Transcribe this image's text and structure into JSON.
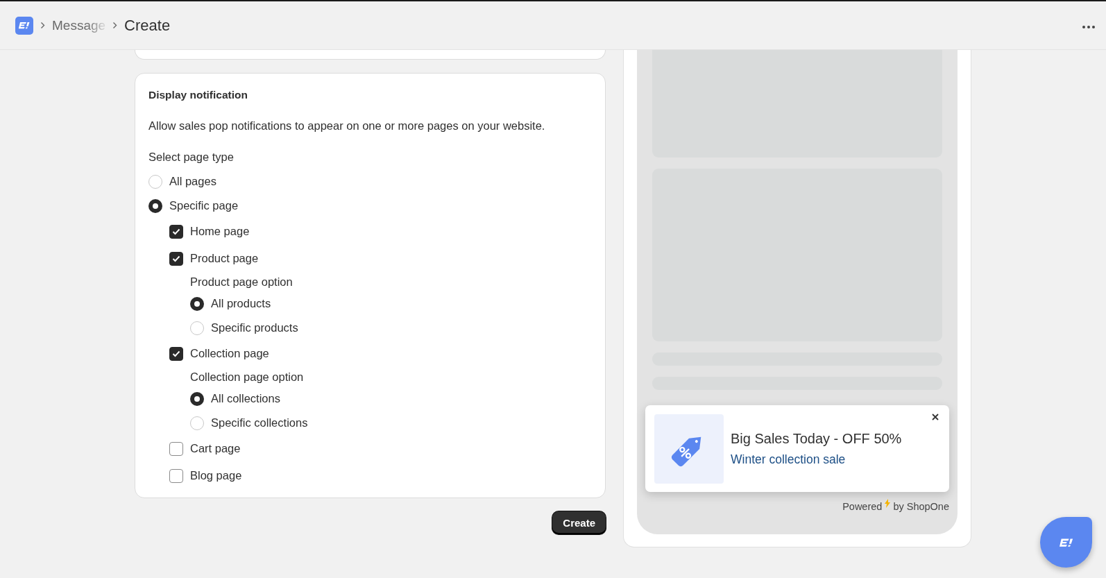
{
  "breadcrumb": {
    "items": [
      {
        "label": "Message"
      }
    ],
    "current": "Create"
  },
  "display_card": {
    "title": "Display notification",
    "description": "Allow sales pop notifications to appear on one or more pages on your website.",
    "field_label": "Select page type",
    "options": [
      {
        "kind": "radio",
        "label": "All pages",
        "selected": false
      },
      {
        "kind": "radio",
        "label": "Specific page",
        "selected": true,
        "children": [
          {
            "kind": "checkbox",
            "label": "Home page",
            "checked": true
          },
          {
            "kind": "checkbox",
            "label": "Product page",
            "checked": true,
            "children": [
              {
                "kind": "label",
                "label": "Product page option"
              },
              {
                "kind": "radio",
                "label": "All products",
                "selected": true
              },
              {
                "kind": "radio",
                "label": "Specific products",
                "selected": false
              }
            ]
          },
          {
            "kind": "checkbox",
            "label": "Collection page",
            "checked": true,
            "children": [
              {
                "kind": "label",
                "label": "Collection page option"
              },
              {
                "kind": "radio",
                "label": "All collections",
                "selected": true
              },
              {
                "kind": "radio",
                "label": "Specific collections",
                "selected": false
              }
            ]
          },
          {
            "kind": "checkbox",
            "label": "Cart page",
            "checked": false
          },
          {
            "kind": "checkbox",
            "label": "Blog page",
            "checked": false
          }
        ]
      }
    ]
  },
  "create_button": "Create",
  "preview": {
    "toast": {
      "title": "Big Sales Today - OFF 50%",
      "subtitle": "Winter collection sale"
    },
    "powered": "Powered",
    "by": "by ShopOne"
  }
}
